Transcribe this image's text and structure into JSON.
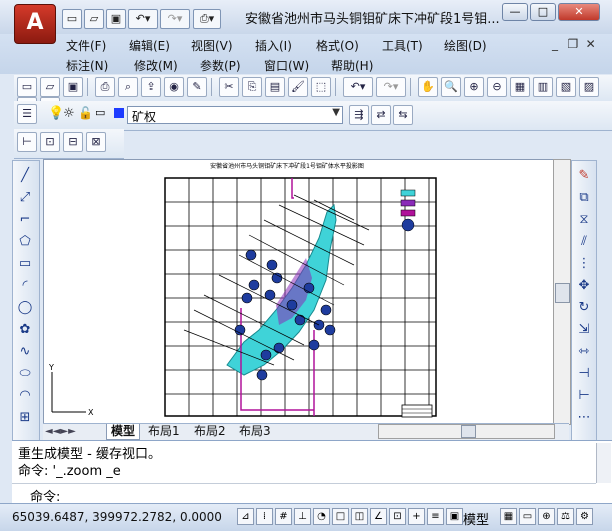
{
  "window": {
    "title": "安徽省池州市马头铜钼矿床下冲矿段1号钼...",
    "app_logo": "A",
    "quick_access": [
      "new-icon",
      "open-icon",
      "save-icon",
      "undo-icon",
      "redo-icon",
      "plot-icon"
    ],
    "controls": {
      "minimize": "—",
      "restore": "□",
      "close": "✕"
    }
  },
  "menu": {
    "row1": [
      "文件(F)",
      "编辑(E)",
      "视图(V)",
      "插入(I)",
      "格式(O)",
      "工具(T)",
      "绘图(D)"
    ],
    "row2": [
      "标注(N)",
      "修改(M)",
      "参数(P)",
      "窗口(W)",
      "帮助(H)"
    ],
    "mdi_controls": {
      "minimize": "_",
      "restore": "❐",
      "close": "✕"
    }
  },
  "layer": {
    "current": "矿权",
    "color": "#1e3cff"
  },
  "drawing": {
    "plot_title": "安徽省池州市马头铜钼矿床下冲矿段1号钼矿体水平投影图"
  },
  "layout_tabs": [
    "模型",
    "布局1",
    "布局2",
    "布局3"
  ],
  "command": {
    "history1": "重生成模型 - 缓存视口。",
    "history2": "命令: '_.zoom _e",
    "prompt": "命令:"
  },
  "status": {
    "coords": "65039.6487, 399972.2782, 0.0000",
    "mode": "模型"
  },
  "colors": {
    "ore_body": "#3fd3d8",
    "hatch": "#8a2bb8",
    "boundary": "#b0129a",
    "grid": "#000000"
  }
}
